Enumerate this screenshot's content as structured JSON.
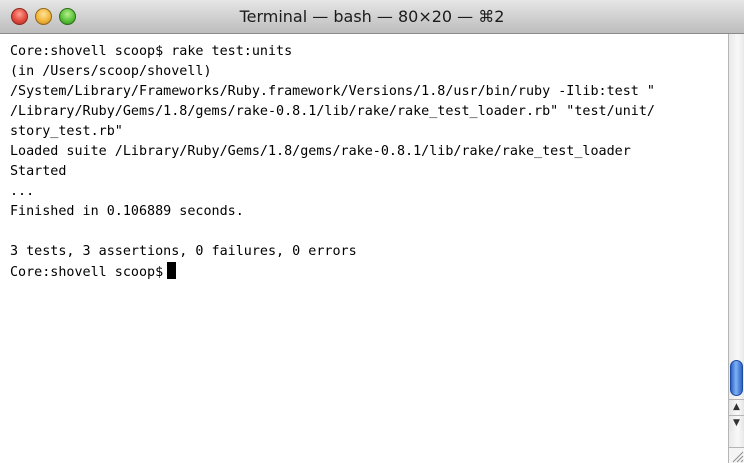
{
  "window": {
    "title": "Terminal — bash — 80×20 — ⌘2"
  },
  "titlebar": {
    "buttons": {
      "close": {
        "icon": "close-icon",
        "color": "#e24b3c"
      },
      "minimize": {
        "icon": "minimize-icon",
        "color": "#f1b63a"
      },
      "zoom": {
        "icon": "zoom-icon",
        "color": "#5cc23a"
      }
    }
  },
  "terminal": {
    "lines": [
      "Core:shovell scoop$ rake test:units",
      "(in /Users/scoop/shovell)",
      "/System/Library/Frameworks/Ruby.framework/Versions/1.8/usr/bin/ruby -Ilib:test \"",
      "/Library/Ruby/Gems/1.8/gems/rake-0.8.1/lib/rake/rake_test_loader.rb\" \"test/unit/",
      "story_test.rb\"",
      "Loaded suite /Library/Ruby/Gems/1.8/gems/rake-0.8.1/lib/rake/rake_test_loader",
      "Started",
      "...",
      "Finished in 0.106889 seconds.",
      "",
      "3 tests, 3 assertions, 0 failures, 0 errors"
    ],
    "prompt": "Core:shovell scoop$"
  },
  "scrollbar": {
    "up_arrow": "▲",
    "down_arrow": "▼",
    "accent": "#2a63c8"
  }
}
